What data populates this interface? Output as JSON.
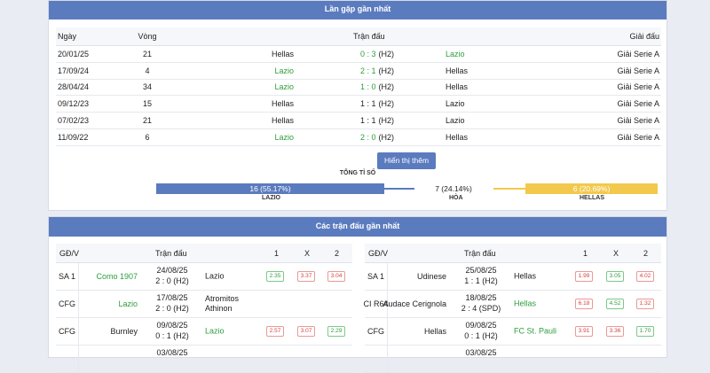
{
  "h2h": {
    "title": "Lần gặp gần nhất",
    "headers": {
      "date": "Ngày",
      "round": "Vòng",
      "match": "Trận đấu",
      "league": "Giải đấu"
    },
    "rows": [
      {
        "date": "20/01/25",
        "round": "21",
        "home": "Hellas",
        "home_win": false,
        "score": "0 : 3",
        "score_green": true,
        "ht": "(H2)",
        "away": "Lazio",
        "away_win": true,
        "league": "Giải Serie A"
      },
      {
        "date": "17/09/24",
        "round": "4",
        "home": "Lazio",
        "home_win": true,
        "score": "2 : 1",
        "score_green": true,
        "ht": "(H2)",
        "away": "Hellas",
        "away_win": false,
        "league": "Giải Serie A"
      },
      {
        "date": "28/04/24",
        "round": "34",
        "home": "Lazio",
        "home_win": true,
        "score": "1 : 0",
        "score_green": true,
        "ht": "(H2)",
        "away": "Hellas",
        "away_win": false,
        "league": "Giải Serie A"
      },
      {
        "date": "09/12/23",
        "round": "15",
        "home": "Hellas",
        "home_win": false,
        "score": "1 : 1",
        "score_green": false,
        "ht": "(H2)",
        "away": "Lazio",
        "away_win": false,
        "league": "Giải Serie A"
      },
      {
        "date": "07/02/23",
        "round": "21",
        "home": "Hellas",
        "home_win": false,
        "score": "1 : 1",
        "score_green": false,
        "ht": "(H2)",
        "away": "Lazio",
        "away_win": false,
        "league": "Giải Serie A"
      },
      {
        "date": "11/09/22",
        "round": "6",
        "home": "Lazio",
        "home_win": true,
        "score": "2 : 0",
        "score_green": true,
        "ht": "(H2)",
        "away": "Hellas",
        "away_win": false,
        "league": "Giải Serie A"
      }
    ],
    "show_more_label": "Hiển thị thêm",
    "summary_caption": "TỔNG TỈ SỐ",
    "summary": {
      "lazio_value": "16 (55.17%)",
      "lazio_label": "LAZIO",
      "draw_value": "7 (24.14%)",
      "draw_label": "HÒA",
      "hellas_value": "6 (20.69%)",
      "hellas_label": "HELLAS"
    }
  },
  "recent": {
    "title": "Các trận đấu gần nhất",
    "headers": {
      "stage": "GĐ/V",
      "match": "Trận đấu",
      "h": "1",
      "x": "X",
      "a": "2"
    },
    "left": [
      {
        "stage": "SA 1",
        "home": "Como 1907",
        "home_green": true,
        "date": "24/08/25",
        "score": "2 : 0 (H2)",
        "away": "Lazio",
        "away_green": false,
        "odds": [
          "2.35",
          "3.37",
          "3.04"
        ],
        "odds_colors": [
          "green",
          "red",
          "red"
        ]
      },
      {
        "stage": "CFG",
        "home": "Lazio",
        "home_green": true,
        "date": "17/08/25",
        "score": "2 : 0 (H2)",
        "away": "Atromitos Athinon",
        "away_green": false,
        "odds": [],
        "odds_colors": []
      },
      {
        "stage": "CFG",
        "home": "Burnley",
        "home_green": false,
        "date": "09/08/25",
        "score": "0 : 1 (H2)",
        "away": "Lazio",
        "away_green": true,
        "odds": [
          "2.57",
          "3.07",
          "2.29"
        ],
        "odds_colors": [
          "red",
          "red",
          "green"
        ]
      },
      {
        "stage": "",
        "home": "",
        "home_green": false,
        "date": "03/08/25",
        "score": "",
        "away": "",
        "away_green": false,
        "odds": [],
        "odds_colors": []
      }
    ],
    "right": [
      {
        "stage": "SA 1",
        "home": "Udinese",
        "home_green": false,
        "date": "25/08/25",
        "score": "1 : 1 (H2)",
        "away": "Hellas",
        "away_green": false,
        "odds": [
          "1.99",
          "3.05",
          "4.02"
        ],
        "odds_colors": [
          "red",
          "green",
          "red"
        ]
      },
      {
        "stage": "CI R64",
        "home": "Audace Cerignola",
        "home_green": false,
        "date": "18/08/25",
        "score": "2 : 4 (SPD)",
        "away": "Hellas",
        "away_green": true,
        "odds": [
          "6.18",
          "4.52",
          "1.32"
        ],
        "odds_colors": [
          "red",
          "green",
          "red"
        ]
      },
      {
        "stage": "CFG",
        "home": "Hellas",
        "home_green": false,
        "date": "09/08/25",
        "score": "0 : 1 (H2)",
        "away": "FC St. Pauli",
        "away_green": true,
        "odds": [
          "3.91",
          "3.36",
          "1.70"
        ],
        "odds_colors": [
          "red",
          "red",
          "green"
        ]
      },
      {
        "stage": "",
        "home": "",
        "home_green": false,
        "date": "03/08/25",
        "score": "",
        "away": "",
        "away_green": false,
        "odds": [],
        "odds_colors": []
      }
    ]
  },
  "colors": {
    "accent": "#5b7bbf",
    "win_green": "#2e9e3c",
    "loss_red": "#d9413b",
    "hellas_yellow": "#f2c94c"
  }
}
